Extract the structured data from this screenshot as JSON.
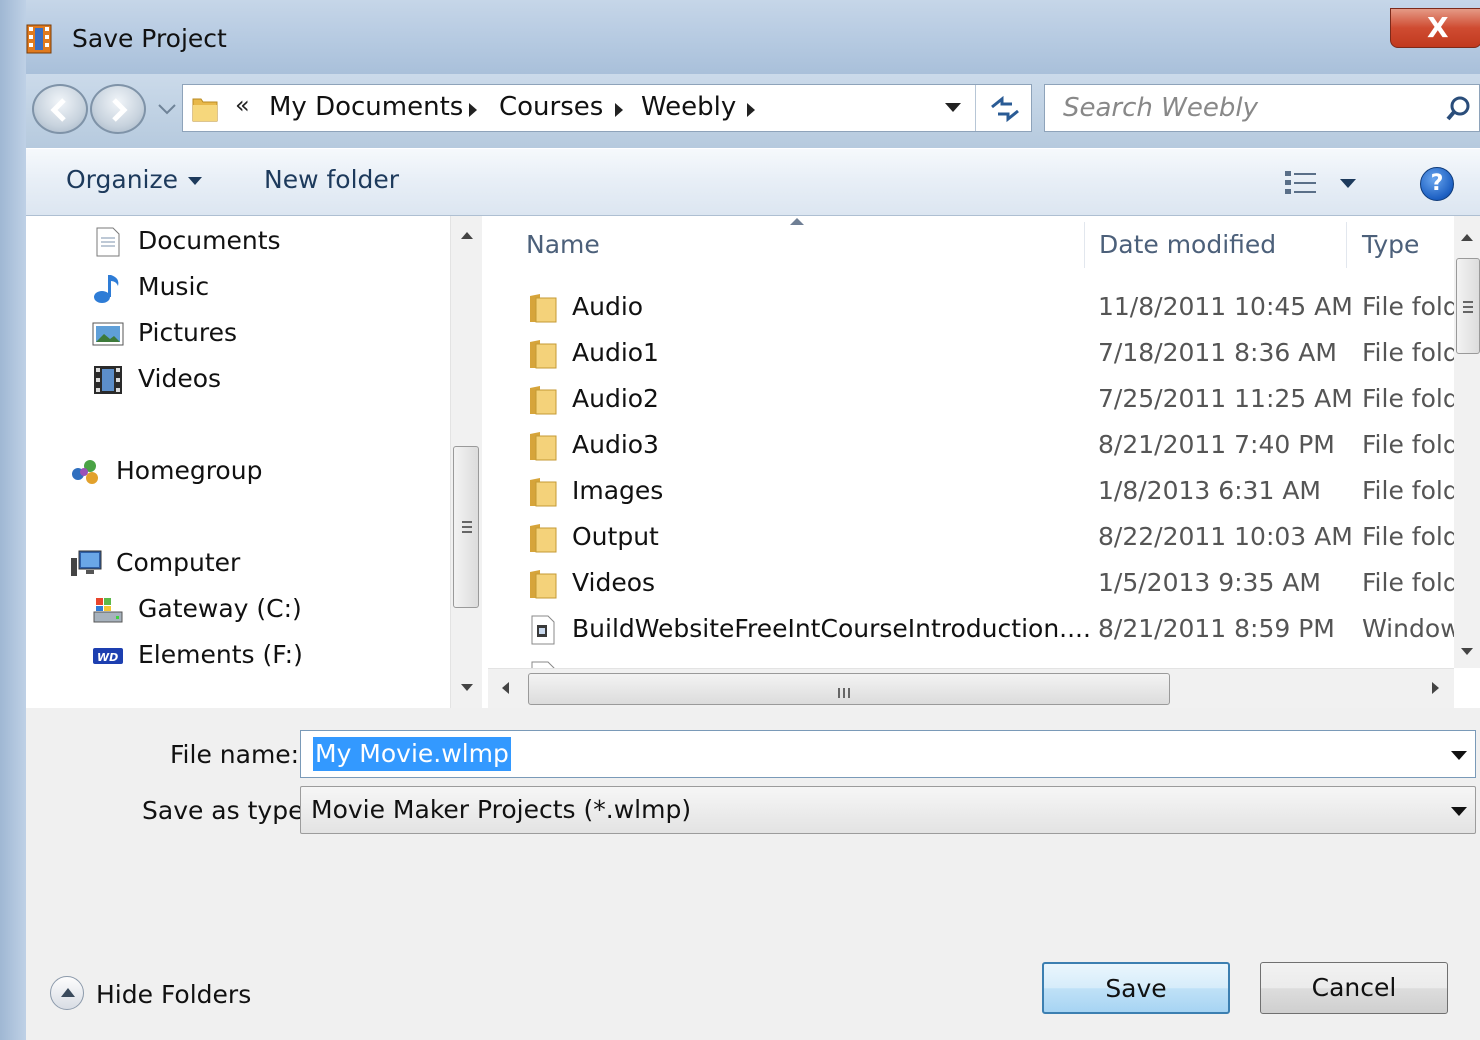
{
  "window": {
    "title": "Save Project",
    "close_label": "X"
  },
  "address_bar": {
    "overflow": "«",
    "crumbs": [
      "My Documents",
      "Courses",
      "Weebly"
    ]
  },
  "search": {
    "placeholder": "Search Weebly"
  },
  "toolbar": {
    "organize": "Organize",
    "new_folder": "New folder",
    "help": "?"
  },
  "nav_pane": {
    "items": [
      {
        "label": "Documents",
        "icon": "document-icon"
      },
      {
        "label": "Music",
        "icon": "music-icon"
      },
      {
        "label": "Pictures",
        "icon": "pictures-icon"
      },
      {
        "label": "Videos",
        "icon": "videos-icon"
      },
      {
        "label": "Homegroup",
        "icon": "homegroup-icon"
      },
      {
        "label": "Computer",
        "icon": "computer-icon"
      },
      {
        "label": "Gateway (C:)",
        "icon": "drive-icon",
        "selected": true
      },
      {
        "label": "Elements (F:)",
        "icon": "wd-drive-icon"
      }
    ]
  },
  "file_list": {
    "columns": [
      "Name",
      "Date modified",
      "Type"
    ],
    "rows": [
      {
        "name": "Audio",
        "date": "11/8/2011 10:45 AM",
        "type": "File fold",
        "kind": "folder"
      },
      {
        "name": "Audio1",
        "date": "7/18/2011 8:36 AM",
        "type": "File fold",
        "kind": "folder"
      },
      {
        "name": "Audio2",
        "date": "7/25/2011 11:25 AM",
        "type": "File fold",
        "kind": "folder"
      },
      {
        "name": "Audio3",
        "date": "8/21/2011 7:40 PM",
        "type": "File fold",
        "kind": "folder"
      },
      {
        "name": "Images",
        "date": "1/8/2013 6:31 AM",
        "type": "File fold",
        "kind": "folder"
      },
      {
        "name": "Output",
        "date": "8/22/2011 10:03 AM",
        "type": "File fold",
        "kind": "folder"
      },
      {
        "name": "Videos",
        "date": "1/5/2013 9:35 AM",
        "type": "File fold",
        "kind": "folder"
      },
      {
        "name": "BuildWebsiteFreeIntCourseIntroduction....",
        "date": "8/21/2011 8:59 PM",
        "type": "Window",
        "kind": "file"
      }
    ],
    "hscroll_grip": "III"
  },
  "form": {
    "file_name_label": "File name:",
    "file_name_value": "My Movie.wlmp",
    "save_type_label": "Save as type:",
    "save_type_value": "Movie Maker Projects (*.wlmp)"
  },
  "footer": {
    "hide_folders": "Hide Folders",
    "save": "Save",
    "cancel": "Cancel"
  },
  "colors": {
    "accent": "#3399ff",
    "titlebar": "#b7cbe2",
    "close": "#c13a1f"
  }
}
